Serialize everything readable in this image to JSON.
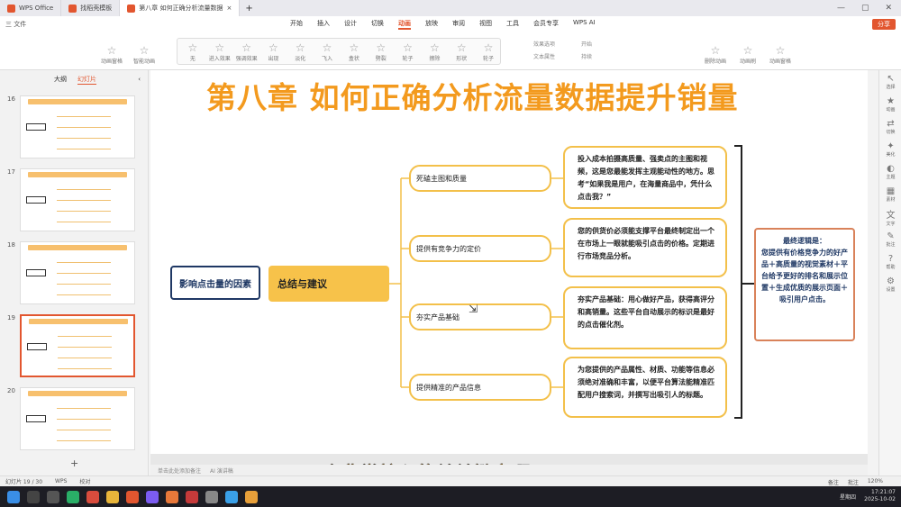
{
  "tabs": [
    {
      "label": "WPS Office",
      "color": "#e2562f"
    },
    {
      "label": "找稻壳模板",
      "color": "#e2562f"
    },
    {
      "label": "第八章 如何正确分析流量数据",
      "color": "#e2562f"
    }
  ],
  "menu": {
    "left": [
      "三 文件"
    ],
    "items": [
      "开始",
      "插入",
      "设计",
      "切换",
      "动画",
      "放映",
      "审阅",
      "视图",
      "工具",
      "会员专享",
      "WPS AI"
    ],
    "active": "动画",
    "share": "分享"
  },
  "ribbon": {
    "left_buttons": [
      "动画窗格",
      "智能动画"
    ],
    "effects": [
      "无",
      "进入效果",
      "强调效果",
      "出现",
      "淡化",
      "飞入",
      "盒状",
      "劈裂",
      "轮子",
      "擦除",
      "形状",
      "轮子"
    ],
    "options": [
      "效果选项",
      "文本属性",
      "开始",
      "持续"
    ],
    "right_buttons": [
      "删除动画",
      "动画刷",
      "动画窗格"
    ]
  },
  "left_panel": {
    "tabs": [
      "大纲",
      "幻灯片"
    ],
    "active_tab": "幻灯片",
    "slides": [
      {
        "num": "16"
      },
      {
        "num": "17"
      },
      {
        "num": "18"
      },
      {
        "num": "19",
        "selected": true
      },
      {
        "num": "20"
      }
    ],
    "add": "+"
  },
  "slide": {
    "title": "第八章 如何正确分析流量数据提升销量",
    "factor": "影响点击量的因素",
    "summary": "总结与建议",
    "categories": [
      "死磕主图和质量",
      "提供有竞争力的定价",
      "夯实产品基础",
      "提供精准的产品信息"
    ],
    "details": [
      "投入成本拍摄高质量、强卖点的主图和视频，这是您最能发挥主观能动性的地方。思考“如果我是用户，在海量商品中，凭什么点击我？”",
      "您的供货价必须能支撑平台最终制定出一个在市场上一眼就能吸引点击的价格。定期进行市场竞品分析。",
      "夯实产品基础：用心做好产品，获得高评分和高销量。这些平台自动展示的标识是最好的点击催化剂。",
      "为您提供的产品属性、材质、功能等信息必须绝对准确和丰富，以便平台算法能精准匹配用户搜索词，并撰写出吸引人的标题。"
    ],
    "logic_title": "最终逻辑是：",
    "logic_body": "您提供有价格竞争力的好产品＋高质量的视觉素材＋平台给予更好的排名和展示位置＋生成优质的展示页面＋吸引用户点击。"
  },
  "caption": "一个非常核心的关关键点啊",
  "notes": {
    "placeholder": "单击此处添加备注",
    "ai": "AI 演讲稿"
  },
  "status": {
    "slide": "幻灯片 19 / 30",
    "app": "WPS",
    "check": "校对",
    "notes": "备注",
    "comment": "批注",
    "zoom": "120%"
  },
  "right_bar": [
    "选择",
    "动画",
    "切换",
    "美化",
    "主题",
    "素材",
    "文字",
    "批注",
    "帮助",
    "设置"
  ],
  "taskbar": {
    "weekday": "星期四",
    "time": "17:21:07",
    "date": "2025-10-02"
  }
}
